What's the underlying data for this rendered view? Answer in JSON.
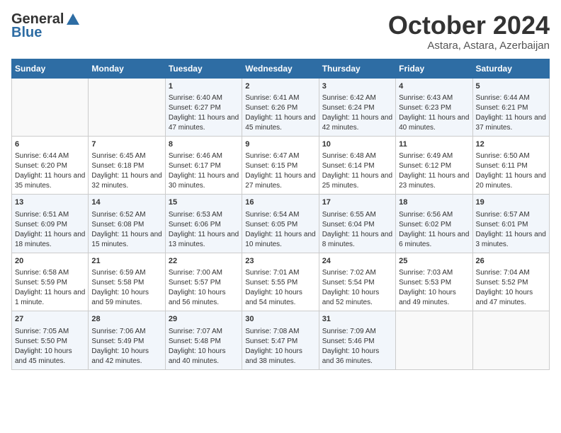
{
  "header": {
    "logo_general": "General",
    "logo_blue": "Blue",
    "month_title": "October 2024",
    "location": "Astara, Astara, Azerbaijan"
  },
  "weekdays": [
    "Sunday",
    "Monday",
    "Tuesday",
    "Wednesday",
    "Thursday",
    "Friday",
    "Saturday"
  ],
  "weeks": [
    [
      {
        "day": "",
        "sunrise": "",
        "sunset": "",
        "daylight": ""
      },
      {
        "day": "",
        "sunrise": "",
        "sunset": "",
        "daylight": ""
      },
      {
        "day": "1",
        "sunrise": "Sunrise: 6:40 AM",
        "sunset": "Sunset: 6:27 PM",
        "daylight": "Daylight: 11 hours and 47 minutes."
      },
      {
        "day": "2",
        "sunrise": "Sunrise: 6:41 AM",
        "sunset": "Sunset: 6:26 PM",
        "daylight": "Daylight: 11 hours and 45 minutes."
      },
      {
        "day": "3",
        "sunrise": "Sunrise: 6:42 AM",
        "sunset": "Sunset: 6:24 PM",
        "daylight": "Daylight: 11 hours and 42 minutes."
      },
      {
        "day": "4",
        "sunrise": "Sunrise: 6:43 AM",
        "sunset": "Sunset: 6:23 PM",
        "daylight": "Daylight: 11 hours and 40 minutes."
      },
      {
        "day": "5",
        "sunrise": "Sunrise: 6:44 AM",
        "sunset": "Sunset: 6:21 PM",
        "daylight": "Daylight: 11 hours and 37 minutes."
      }
    ],
    [
      {
        "day": "6",
        "sunrise": "Sunrise: 6:44 AM",
        "sunset": "Sunset: 6:20 PM",
        "daylight": "Daylight: 11 hours and 35 minutes."
      },
      {
        "day": "7",
        "sunrise": "Sunrise: 6:45 AM",
        "sunset": "Sunset: 6:18 PM",
        "daylight": "Daylight: 11 hours and 32 minutes."
      },
      {
        "day": "8",
        "sunrise": "Sunrise: 6:46 AM",
        "sunset": "Sunset: 6:17 PM",
        "daylight": "Daylight: 11 hours and 30 minutes."
      },
      {
        "day": "9",
        "sunrise": "Sunrise: 6:47 AM",
        "sunset": "Sunset: 6:15 PM",
        "daylight": "Daylight: 11 hours and 27 minutes."
      },
      {
        "day": "10",
        "sunrise": "Sunrise: 6:48 AM",
        "sunset": "Sunset: 6:14 PM",
        "daylight": "Daylight: 11 hours and 25 minutes."
      },
      {
        "day": "11",
        "sunrise": "Sunrise: 6:49 AM",
        "sunset": "Sunset: 6:12 PM",
        "daylight": "Daylight: 11 hours and 23 minutes."
      },
      {
        "day": "12",
        "sunrise": "Sunrise: 6:50 AM",
        "sunset": "Sunset: 6:11 PM",
        "daylight": "Daylight: 11 hours and 20 minutes."
      }
    ],
    [
      {
        "day": "13",
        "sunrise": "Sunrise: 6:51 AM",
        "sunset": "Sunset: 6:09 PM",
        "daylight": "Daylight: 11 hours and 18 minutes."
      },
      {
        "day": "14",
        "sunrise": "Sunrise: 6:52 AM",
        "sunset": "Sunset: 6:08 PM",
        "daylight": "Daylight: 11 hours and 15 minutes."
      },
      {
        "day": "15",
        "sunrise": "Sunrise: 6:53 AM",
        "sunset": "Sunset: 6:06 PM",
        "daylight": "Daylight: 11 hours and 13 minutes."
      },
      {
        "day": "16",
        "sunrise": "Sunrise: 6:54 AM",
        "sunset": "Sunset: 6:05 PM",
        "daylight": "Daylight: 11 hours and 10 minutes."
      },
      {
        "day": "17",
        "sunrise": "Sunrise: 6:55 AM",
        "sunset": "Sunset: 6:04 PM",
        "daylight": "Daylight: 11 hours and 8 minutes."
      },
      {
        "day": "18",
        "sunrise": "Sunrise: 6:56 AM",
        "sunset": "Sunset: 6:02 PM",
        "daylight": "Daylight: 11 hours and 6 minutes."
      },
      {
        "day": "19",
        "sunrise": "Sunrise: 6:57 AM",
        "sunset": "Sunset: 6:01 PM",
        "daylight": "Daylight: 11 hours and 3 minutes."
      }
    ],
    [
      {
        "day": "20",
        "sunrise": "Sunrise: 6:58 AM",
        "sunset": "Sunset: 5:59 PM",
        "daylight": "Daylight: 11 hours and 1 minute."
      },
      {
        "day": "21",
        "sunrise": "Sunrise: 6:59 AM",
        "sunset": "Sunset: 5:58 PM",
        "daylight": "Daylight: 10 hours and 59 minutes."
      },
      {
        "day": "22",
        "sunrise": "Sunrise: 7:00 AM",
        "sunset": "Sunset: 5:57 PM",
        "daylight": "Daylight: 10 hours and 56 minutes."
      },
      {
        "day": "23",
        "sunrise": "Sunrise: 7:01 AM",
        "sunset": "Sunset: 5:55 PM",
        "daylight": "Daylight: 10 hours and 54 minutes."
      },
      {
        "day": "24",
        "sunrise": "Sunrise: 7:02 AM",
        "sunset": "Sunset: 5:54 PM",
        "daylight": "Daylight: 10 hours and 52 minutes."
      },
      {
        "day": "25",
        "sunrise": "Sunrise: 7:03 AM",
        "sunset": "Sunset: 5:53 PM",
        "daylight": "Daylight: 10 hours and 49 minutes."
      },
      {
        "day": "26",
        "sunrise": "Sunrise: 7:04 AM",
        "sunset": "Sunset: 5:52 PM",
        "daylight": "Daylight: 10 hours and 47 minutes."
      }
    ],
    [
      {
        "day": "27",
        "sunrise": "Sunrise: 7:05 AM",
        "sunset": "Sunset: 5:50 PM",
        "daylight": "Daylight: 10 hours and 45 minutes."
      },
      {
        "day": "28",
        "sunrise": "Sunrise: 7:06 AM",
        "sunset": "Sunset: 5:49 PM",
        "daylight": "Daylight: 10 hours and 42 minutes."
      },
      {
        "day": "29",
        "sunrise": "Sunrise: 7:07 AM",
        "sunset": "Sunset: 5:48 PM",
        "daylight": "Daylight: 10 hours and 40 minutes."
      },
      {
        "day": "30",
        "sunrise": "Sunrise: 7:08 AM",
        "sunset": "Sunset: 5:47 PM",
        "daylight": "Daylight: 10 hours and 38 minutes."
      },
      {
        "day": "31",
        "sunrise": "Sunrise: 7:09 AM",
        "sunset": "Sunset: 5:46 PM",
        "daylight": "Daylight: 10 hours and 36 minutes."
      },
      {
        "day": "",
        "sunrise": "",
        "sunset": "",
        "daylight": ""
      },
      {
        "day": "",
        "sunrise": "",
        "sunset": "",
        "daylight": ""
      }
    ]
  ]
}
